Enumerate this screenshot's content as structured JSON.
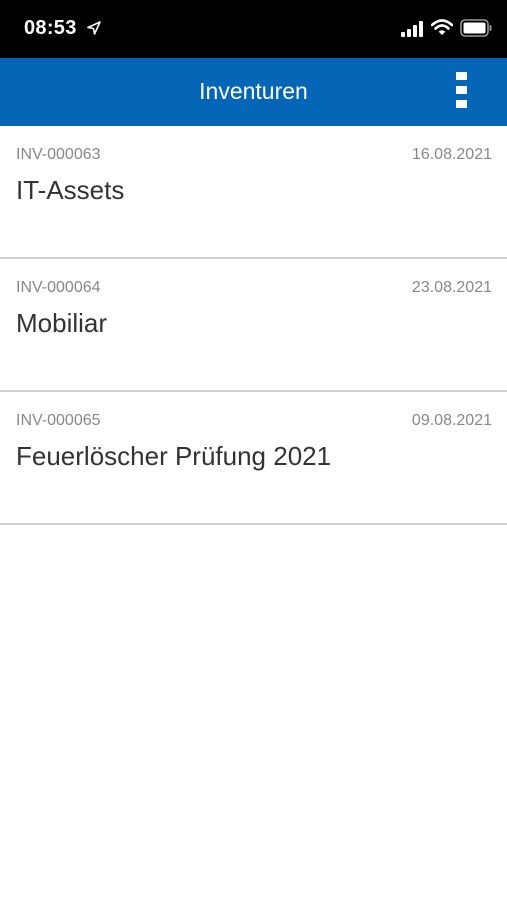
{
  "status_bar": {
    "time": "08:53",
    "icons": [
      "location-arrow-icon",
      "cellular-signal-icon",
      "wifi-icon",
      "battery-icon"
    ]
  },
  "header": {
    "title": "Inventuren",
    "menu_icon": "more-vertical-icon",
    "background_color": "#0565b6"
  },
  "inventories": [
    {
      "id": "INV-000063",
      "date": "16.08.2021",
      "title": "IT-Assets"
    },
    {
      "id": "INV-000064",
      "date": "23.08.2021",
      "title": "Mobiliar"
    },
    {
      "id": "INV-000065",
      "date": "09.08.2021",
      "title": "Feuerlöscher Prüfung 2021"
    }
  ]
}
